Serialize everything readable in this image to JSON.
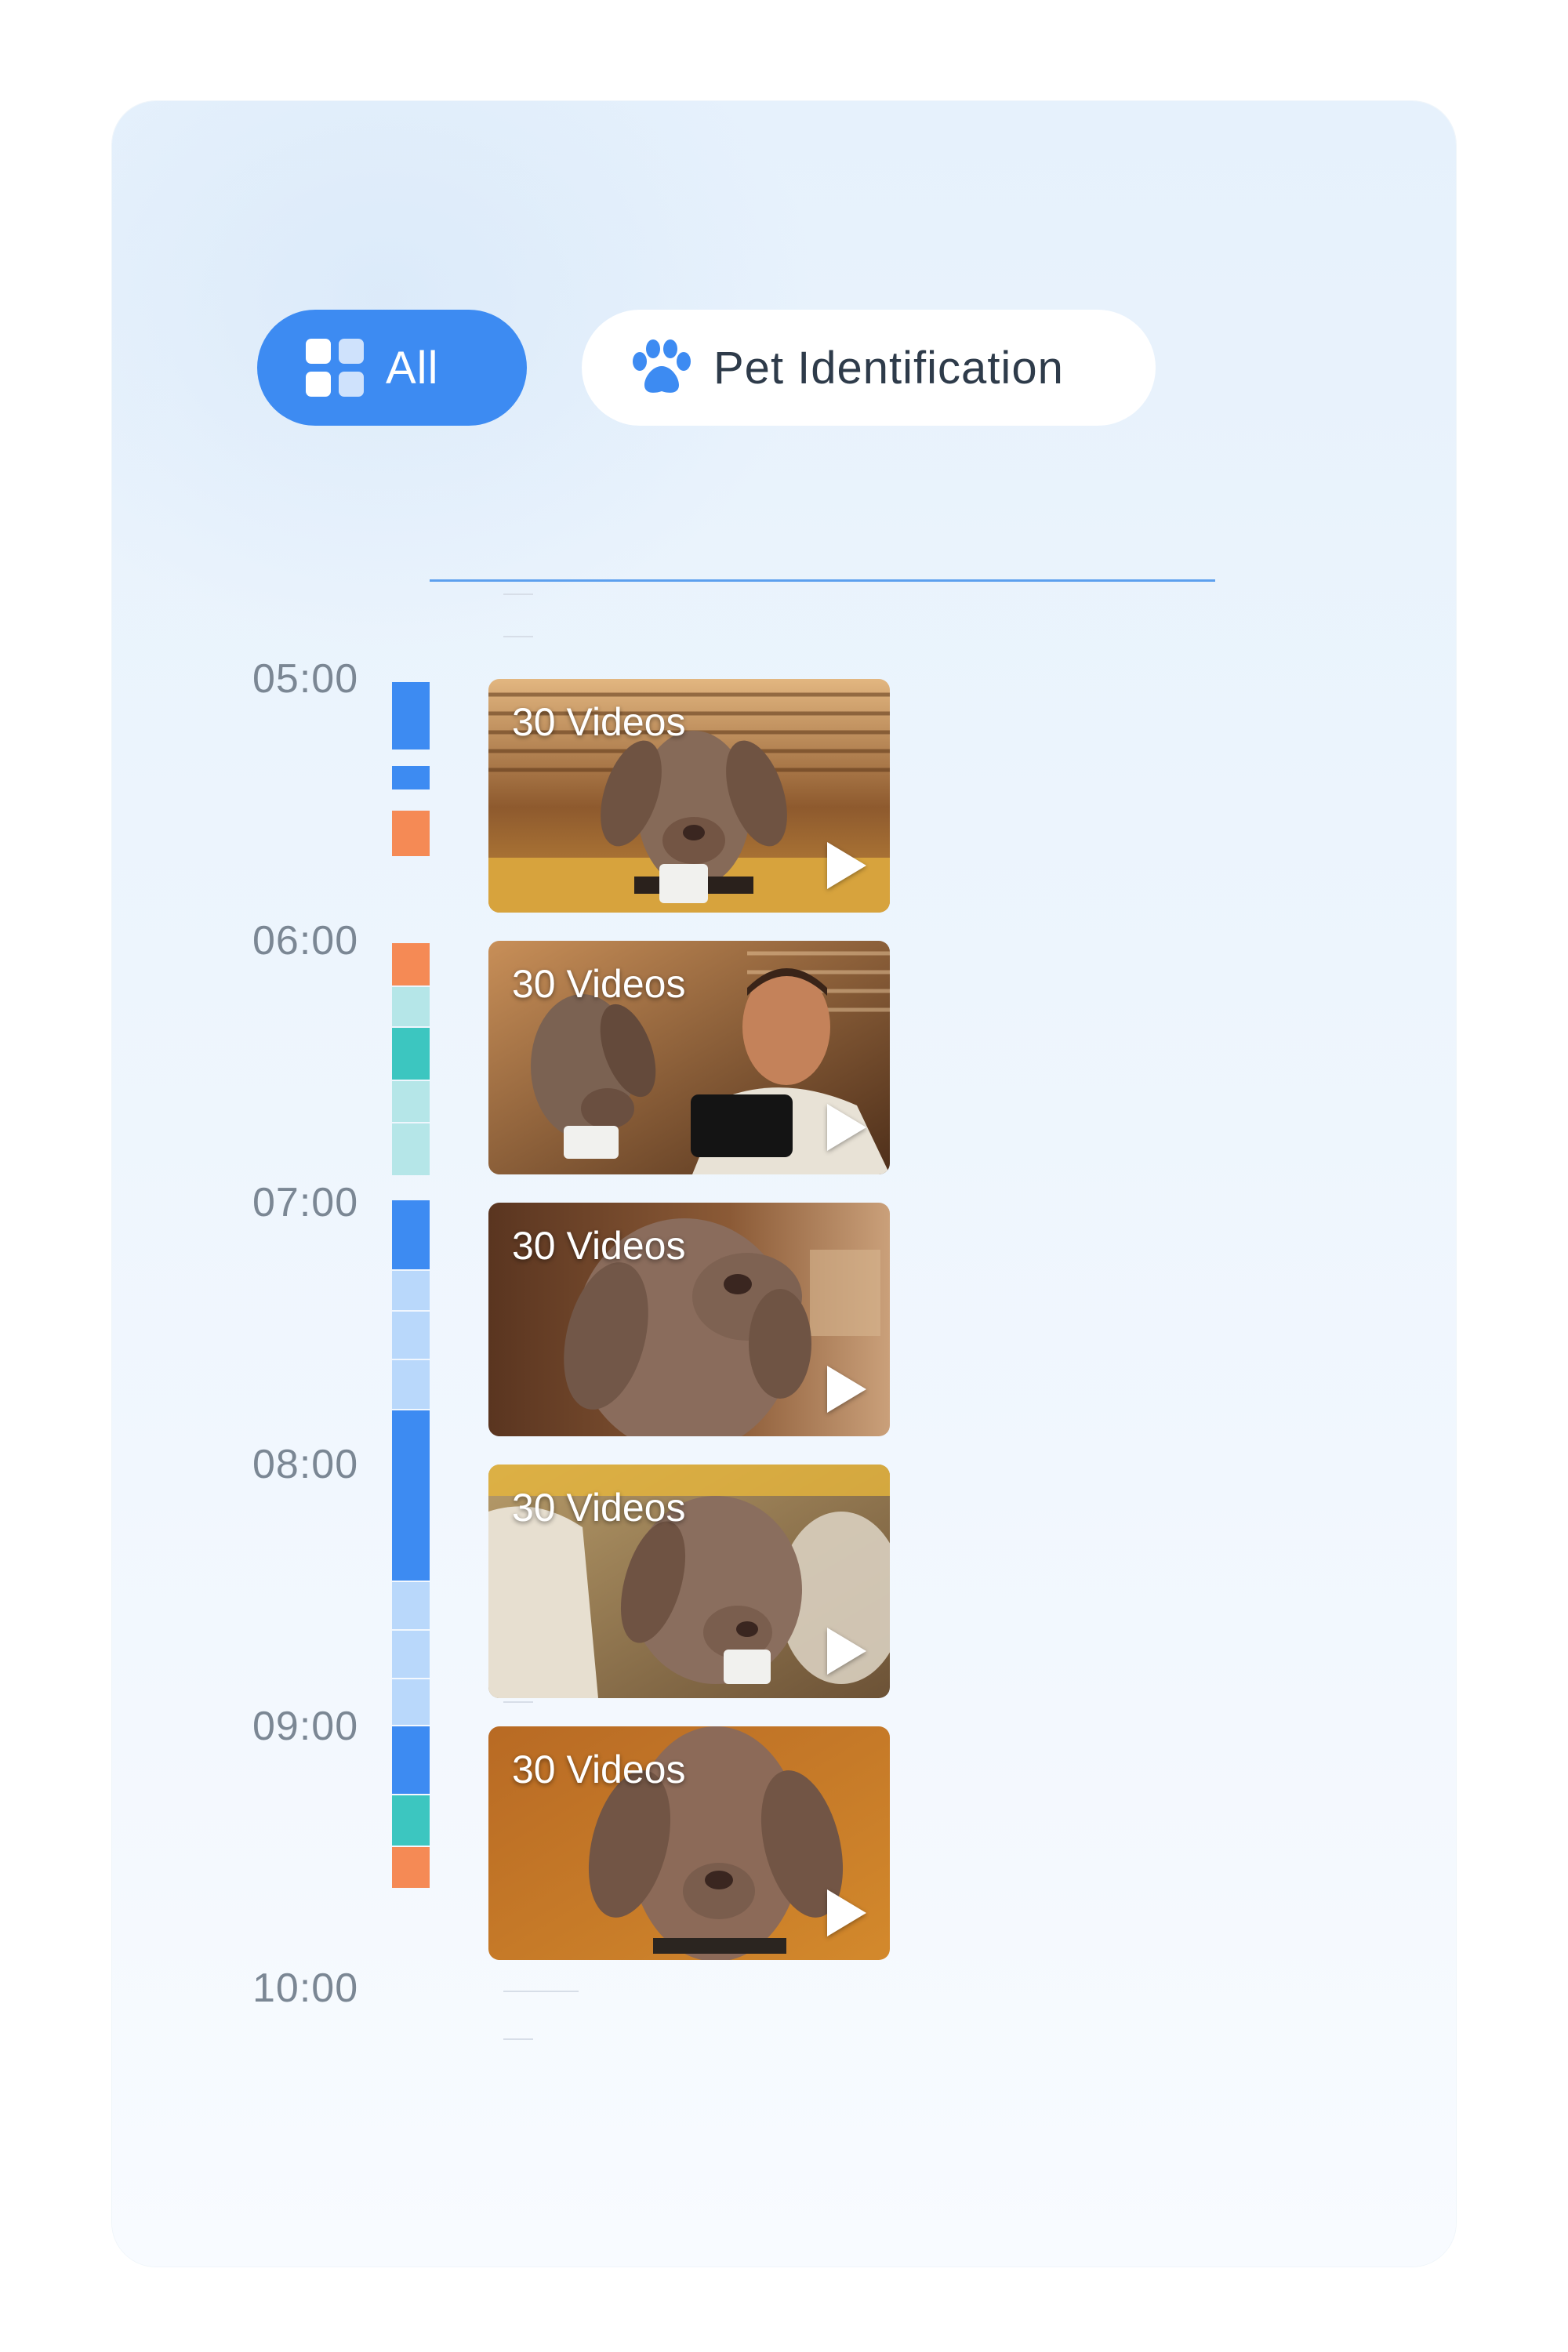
{
  "filters": {
    "all_label": "All",
    "pet_label": "Pet Identification",
    "all_icon": "grid-icon",
    "pet_icon": "paw-icon",
    "active": "All"
  },
  "colors": {
    "accent": "#3d8bf2",
    "blue": "#3d8bf2",
    "light_blue": "#b9d8fb",
    "orange": "#f58a55",
    "teal": "#3cc6c0",
    "light_teal": "#b5e6e8"
  },
  "timeline": {
    "hours": [
      "05:00",
      "06:00",
      "07:00",
      "08:00",
      "09:00",
      "10:00"
    ]
  },
  "clips": [
    {
      "label": "30 Videos"
    },
    {
      "label": "30 Videos"
    },
    {
      "label": "30 Videos"
    },
    {
      "label": "30 Videos"
    },
    {
      "label": "30 Videos"
    }
  ]
}
